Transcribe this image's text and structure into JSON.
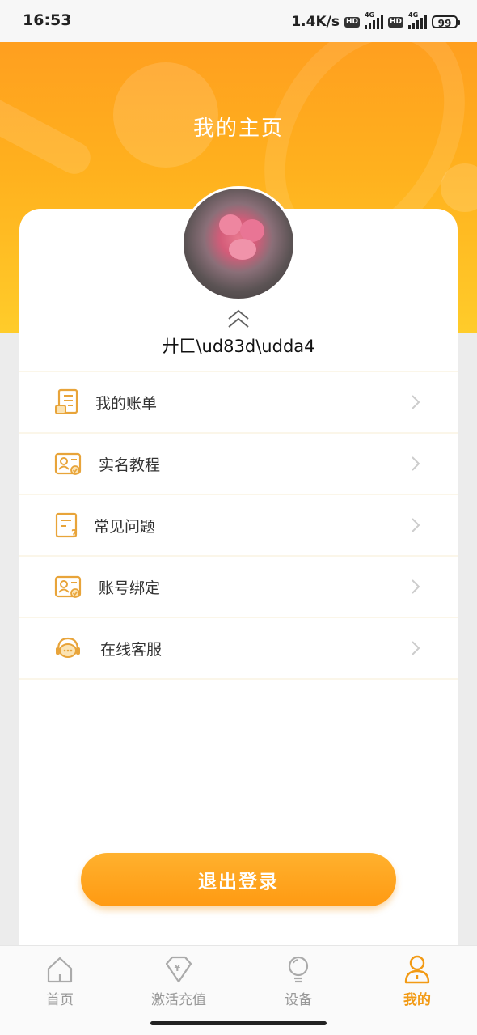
{
  "status_bar": {
    "time": "16:53",
    "network_speed": "1.4K/s",
    "hd_label": "HD",
    "signal_label": "4G",
    "battery": "99"
  },
  "header": {
    "title": "我的主页"
  },
  "profile": {
    "username": "廾匚\\ud83d\\udda4"
  },
  "menu": {
    "items": [
      {
        "label": "我的账单",
        "icon": "bill-icon"
      },
      {
        "label": "实名教程",
        "icon": "id-card-icon"
      },
      {
        "label": "常见问题",
        "icon": "faq-icon"
      },
      {
        "label": "账号绑定",
        "icon": "id-card-icon"
      },
      {
        "label": "在线客服",
        "icon": "headset-icon"
      }
    ]
  },
  "logout": {
    "label": "退出登录"
  },
  "tabbar": {
    "items": [
      {
        "label": "首页",
        "icon": "home-icon",
        "active": false
      },
      {
        "label": "激活充值",
        "icon": "yen-diamond-icon",
        "active": false
      },
      {
        "label": "设备",
        "icon": "lightbulb-icon",
        "active": false
      },
      {
        "label": "我的",
        "icon": "user-icon",
        "active": true
      }
    ]
  },
  "colors": {
    "accent": "#f29a14",
    "header_top": "#ff9f1f",
    "header_bottom": "#ffcc2a",
    "icon": "#e8a43a"
  }
}
